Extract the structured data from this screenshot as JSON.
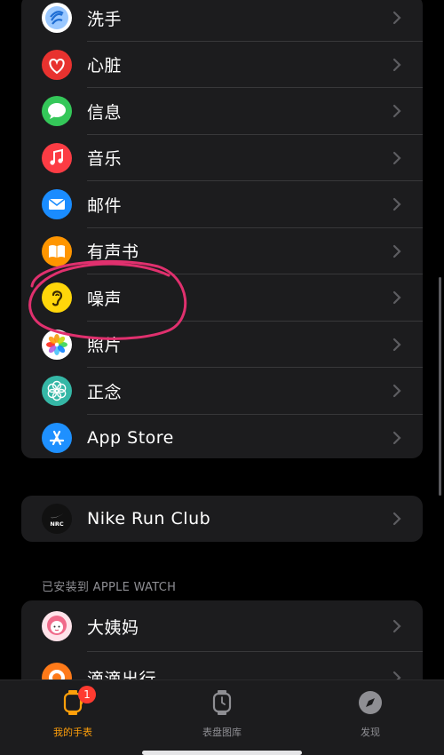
{
  "apps_list": {
    "items": [
      {
        "label": "洗手",
        "icon": "handwashing-icon"
      },
      {
        "label": "心脏",
        "icon": "heart-icon"
      },
      {
        "label": "信息",
        "icon": "messages-icon"
      },
      {
        "label": "音乐",
        "icon": "music-icon"
      },
      {
        "label": "邮件",
        "icon": "mail-icon"
      },
      {
        "label": "有声书",
        "icon": "audiobooks-icon"
      },
      {
        "label": "噪声",
        "icon": "noise-ear-icon"
      },
      {
        "label": "照片",
        "icon": "photos-icon"
      },
      {
        "label": "正念",
        "icon": "mindfulness-icon"
      },
      {
        "label": "App Store",
        "icon": "app-store-icon"
      }
    ]
  },
  "third_party": {
    "items": [
      {
        "label": "Nike Run Club",
        "icon": "nike-run-club-icon"
      }
    ]
  },
  "installed_section": {
    "header": "已安装到 APPLE WATCH",
    "items": [
      {
        "label": "大姨妈",
        "icon": "dayima-icon"
      },
      {
        "label": "滴滴出行",
        "icon": "didi-icon"
      }
    ]
  },
  "tabbar": {
    "tabs": [
      {
        "label": "我的手表",
        "icon": "my-watch-icon",
        "active": true,
        "badge": "1"
      },
      {
        "label": "表盘图库",
        "icon": "face-gallery-icon",
        "active": false
      },
      {
        "label": "发现",
        "icon": "discover-compass-icon",
        "active": false
      }
    ]
  },
  "colors": {
    "background": "#000000",
    "group_bg": "#1c1c1e",
    "accent": "#ff9f0a",
    "annotation": "#e0306e",
    "badge": "#ff3b30"
  }
}
